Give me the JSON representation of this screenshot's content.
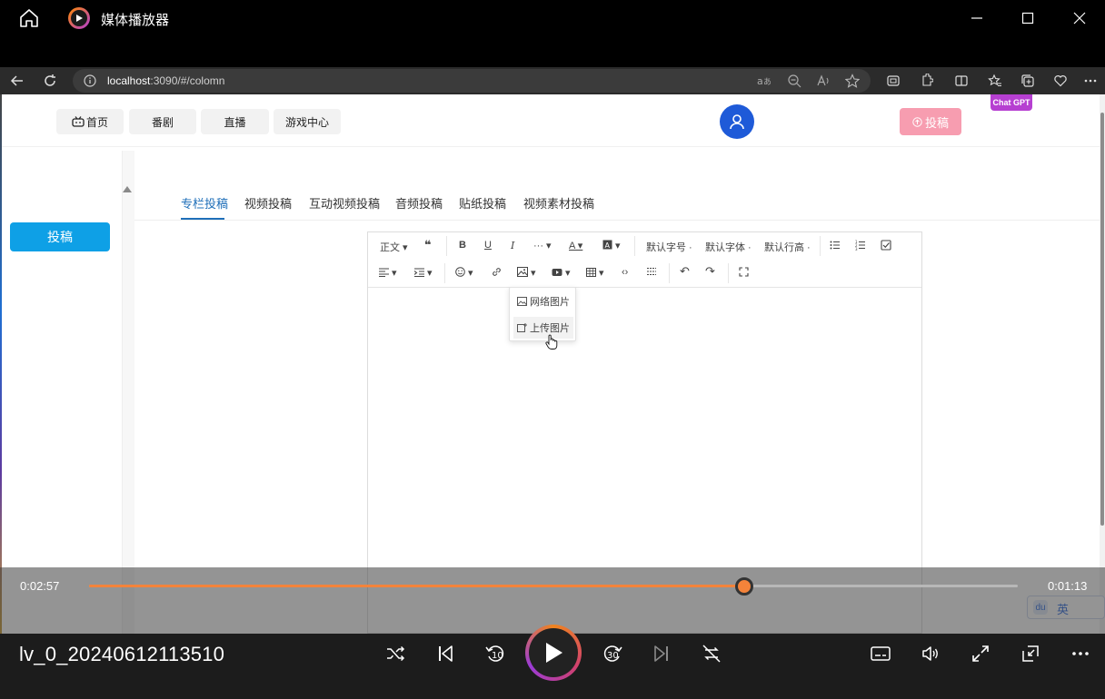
{
  "player": {
    "app_title": "媒体播放器",
    "file_name": "lv_0_20240612113510",
    "elapsed": "0:02:57",
    "remaining": "0:01:13",
    "progress_fraction": 0.705,
    "accent_color": "#f4833a",
    "skip_back_seconds": "10",
    "skip_forward_seconds": "30"
  },
  "browser": {
    "url_host": "localhost",
    "url_rest": ":3090/#/colomn"
  },
  "site": {
    "nav": [
      "首页",
      "番剧",
      "直播",
      "游戏中心"
    ],
    "submit_label": "投稿",
    "chatgpt_label": "Chat GPT",
    "sidebar_submit": "投稿"
  },
  "tabs": [
    "专栏投稿",
    "视频投稿",
    "互动视频投稿",
    "音频投稿",
    "贴纸投稿",
    "视频素材投稿"
  ],
  "editor": {
    "paragraph": "正文",
    "font_size": "默认字号",
    "font_family": "默认字体",
    "line_height": "默认行高",
    "image_menu": [
      "网络图片",
      "上传图片"
    ]
  },
  "ime": {
    "mode": "英"
  }
}
